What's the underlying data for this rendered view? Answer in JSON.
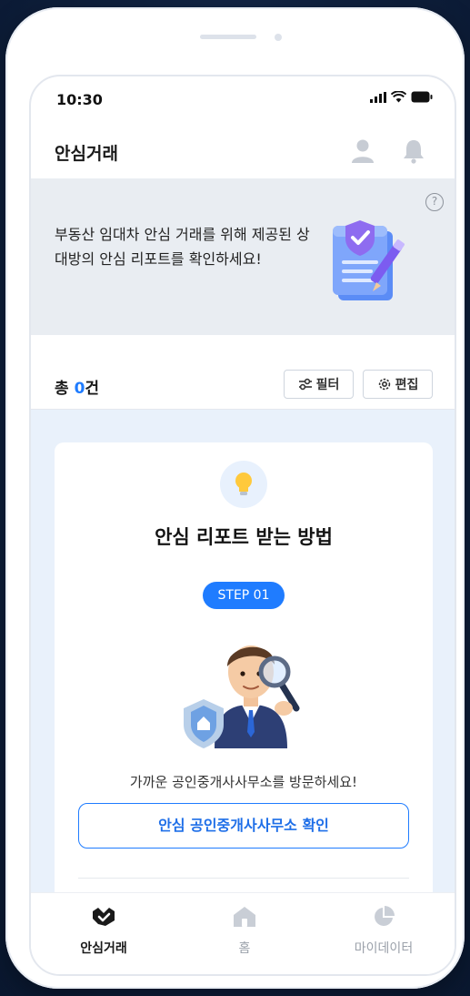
{
  "status_bar": {
    "time": "10:30"
  },
  "header": {
    "title": "안심거래"
  },
  "banner": {
    "text": "부동산 임대차 안심 거래를 위해 제공된 상대방의 안심 리포트를 확인하세요!",
    "help_glyph": "?"
  },
  "summary": {
    "total_prefix": "총 ",
    "total_count": "0",
    "total_suffix": "건",
    "filter_label": "필터",
    "edit_label": "편집"
  },
  "guide_card": {
    "title": "안심 리포트 받는 방법",
    "step_badge": "STEP 01",
    "description": "가까운 공인중개사사무소를 방문하세요!",
    "button_label": "안심 공인중개사사무소 확인"
  },
  "tab_bar": {
    "items": [
      {
        "label": "안심거래",
        "icon": "handshake-icon",
        "active": true
      },
      {
        "label": "홈",
        "icon": "home-icon",
        "active": false
      },
      {
        "label": "마이데이터",
        "icon": "pie-chart-icon",
        "active": false
      }
    ]
  },
  "colors": {
    "accent": "#1f7cff",
    "banner_bg": "#e9edf2",
    "content_bg": "#e9f1fb"
  }
}
